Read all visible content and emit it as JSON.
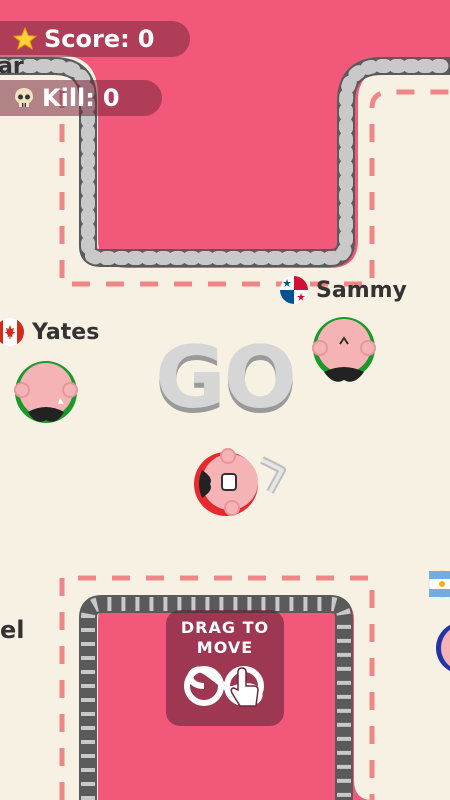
{
  "hud": {
    "score_label": "Score:",
    "score_value": "0",
    "kill_label": "Kill:",
    "kill_value": "0",
    "clipped_name_fragment": "ar"
  },
  "banner": {
    "go_text": "GO"
  },
  "players": [
    {
      "name": "Sammy",
      "flag": "panama"
    },
    {
      "name": "Yates",
      "flag": "canada"
    },
    {
      "name": "",
      "flag": ""
    }
  ],
  "edge_name_fragment": "el",
  "hint": {
    "line1": "DRAG TO",
    "line2": "MOVE"
  },
  "icons": [
    "star-icon",
    "skull-icon",
    "panama-flag-icon",
    "canada-flag-icon",
    "argentina-flag-icon",
    "infinity-icon",
    "hand-pointer-icon",
    "direction-arrow-icon"
  ],
  "colors": {
    "background": "#f2587a",
    "floor": "#f7f1e3",
    "dash": "#f08787",
    "wall": "#5b5b5b"
  }
}
